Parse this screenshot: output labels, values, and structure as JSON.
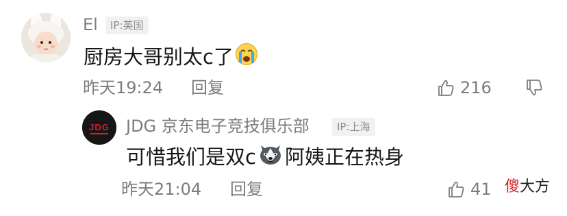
{
  "comment": {
    "username": "El",
    "ip_label": "IP:英国",
    "text_before_emoji": "厨房大哥别太c了",
    "emoji_icon": "crying-face-icon",
    "time": "昨天19:24",
    "reply_label": "回复",
    "likes": "216"
  },
  "reply": {
    "username": "JDG 京东电子竞技俱乐部",
    "ip_label": "IP:上海",
    "text_before_emoji": "可惜我们是双c",
    "emoji_icon": "husky-dog-face-icon",
    "text_after_emoji": "阿姨正在热身",
    "time": "昨天21:04",
    "reply_label": "回复",
    "likes": "41"
  },
  "watermark": {
    "first_char": "傻",
    "rest": "大方"
  },
  "colors": {
    "meta_text": "#7c7c7c",
    "body_text": "#161616",
    "badge_bg": "#f1f1f1",
    "watermark_red": "#d4202b"
  }
}
